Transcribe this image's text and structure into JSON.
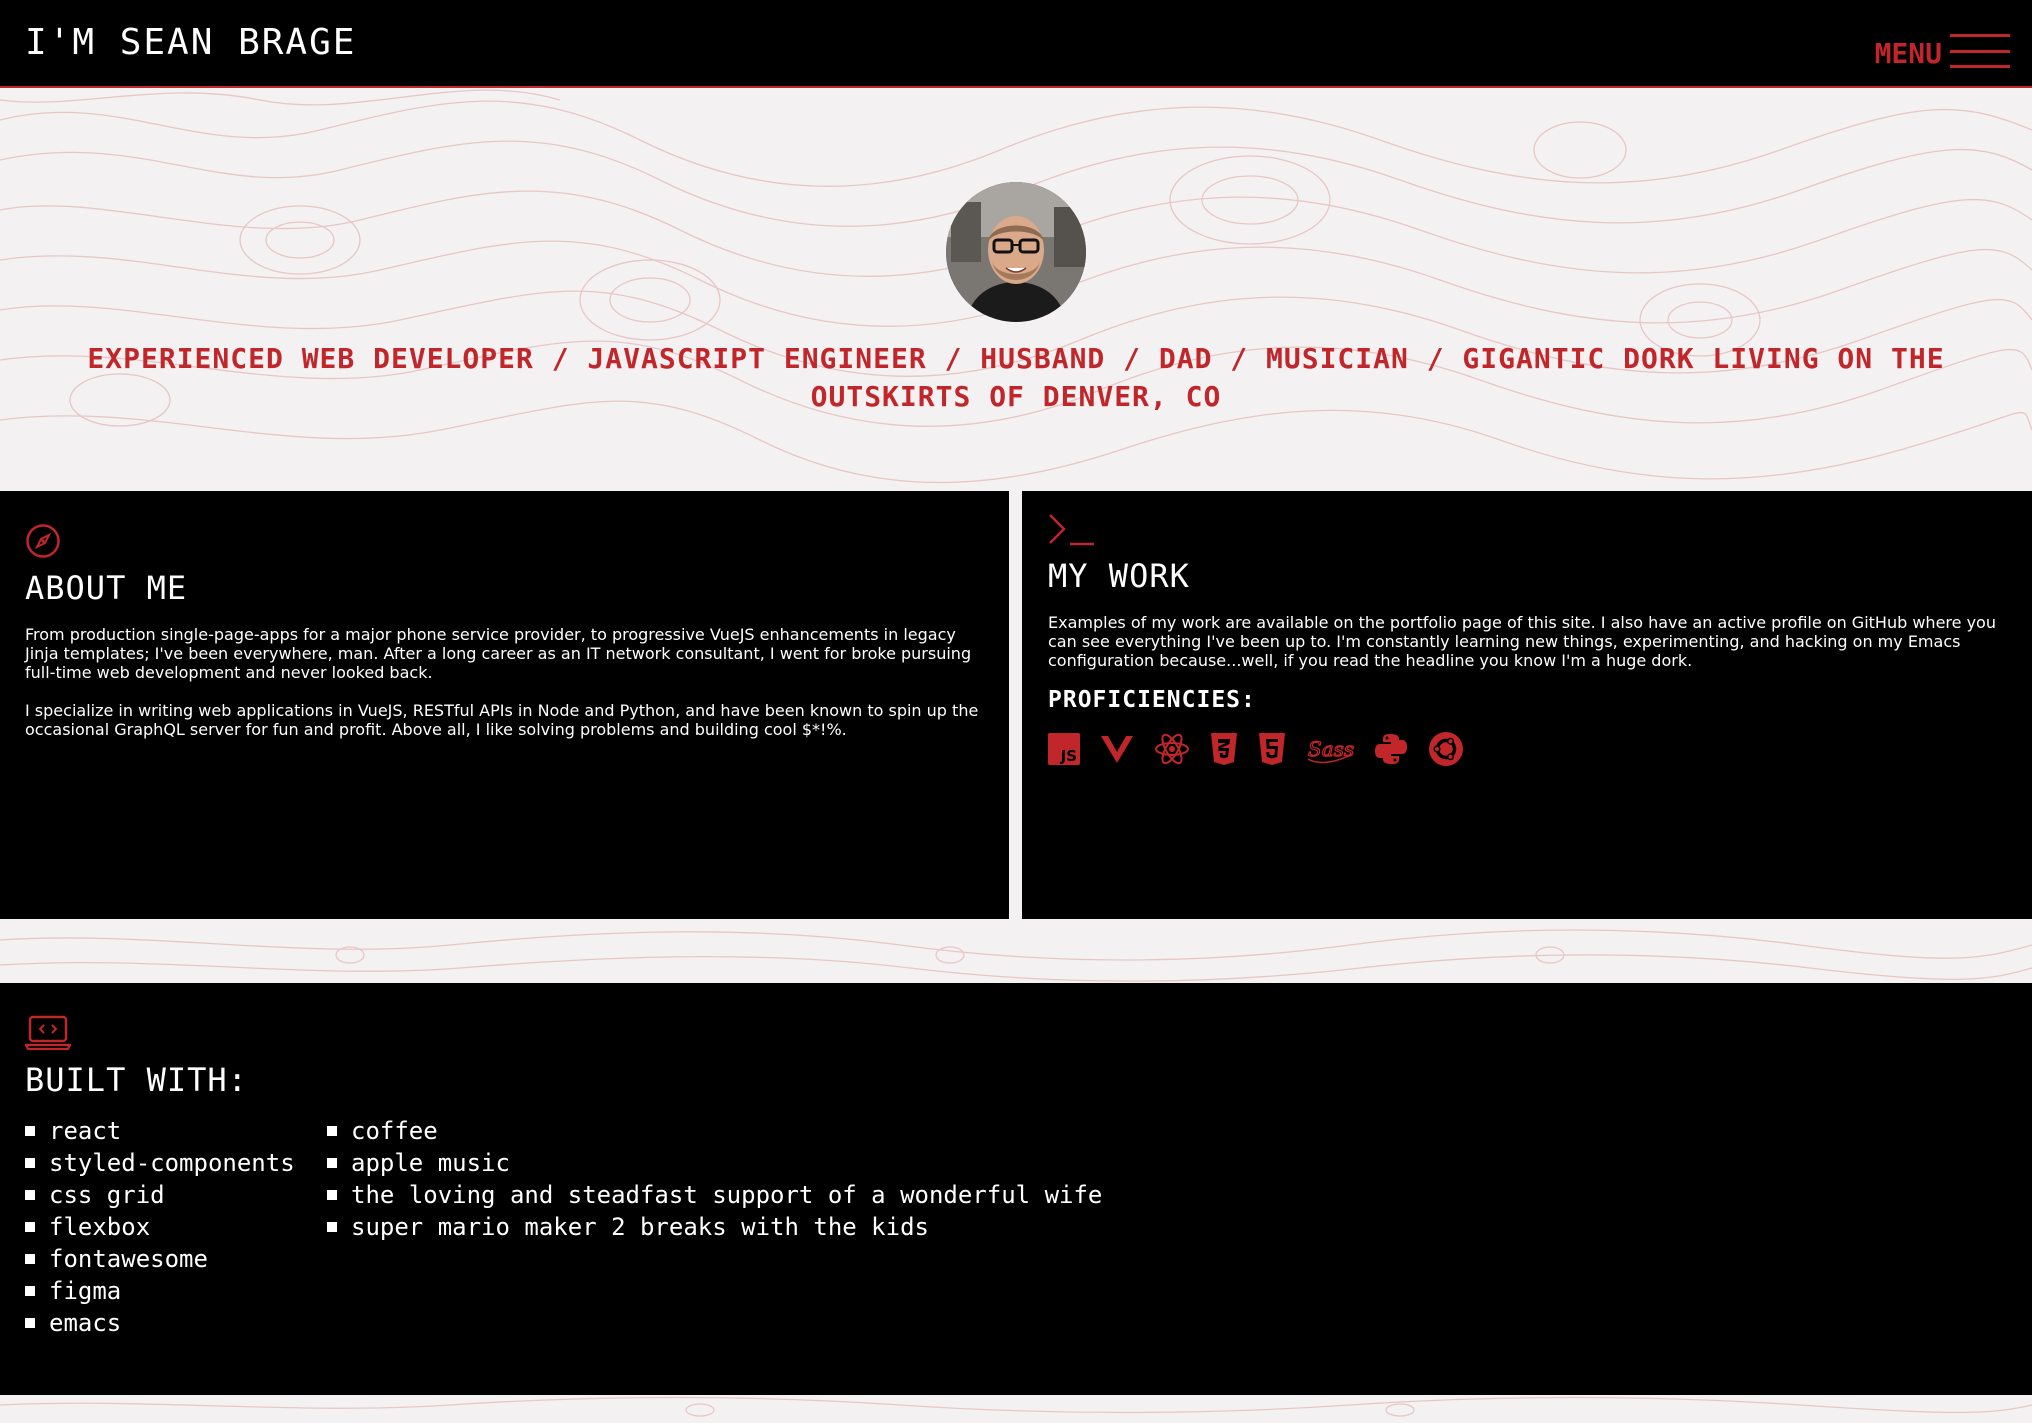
{
  "header": {
    "site_title": "I'M SEAN BRAGE",
    "menu_label": "MENU"
  },
  "hero": {
    "avatar_alt": "avatar",
    "tagline": "EXPERIENCED WEB DEVELOPER / JAVASCRIPT ENGINEER / HUSBAND / DAD / MUSICIAN / GIGANTIC DORK LIVING ON THE OUTSKIRTS OF DENVER, CO"
  },
  "about": {
    "icon": "compass-icon",
    "title": "ABOUT ME",
    "paragraph1": "From production single-page-apps for a major phone service provider, to progressive VueJS enhancements in legacy Jinja templates; I've been everywhere, man. After a long career as an IT network consultant, I went for broke pursuing full-time web development and never looked back.",
    "paragraph2": "I specialize in writing web applications in VueJS, RESTful APIs in Node and Python, and have been known to spin up the occasional GraphQL server for fun and profit. Above all, I like solving problems and building cool $*!%."
  },
  "work": {
    "icon": "terminal-icon",
    "title": "MY WORK",
    "paragraph": "Examples of my work are available on the portfolio page of this site. I also have an active profile on GitHub where you can see everything I've been up to. I'm constantly learning new things, experimenting, and hacking on my Emacs configuration because...well, if you read the headline you know I'm a huge dork.",
    "proficiencies_title": "PROFICIENCIES:",
    "proficiencies": [
      "js-icon",
      "vue-icon",
      "react-icon",
      "css3-icon",
      "html5-icon",
      "sass-icon",
      "python-icon",
      "ubuntu-icon"
    ]
  },
  "built": {
    "icon": "laptop-code-icon",
    "title": "BUILT WITH:",
    "col1": [
      "react",
      "styled-components",
      "css grid",
      "flexbox",
      "fontawesome",
      "figma",
      "emacs"
    ],
    "col2": [
      "coffee",
      "apple music",
      "the loving and steadfast support of a wonderful wife",
      "super mario maker 2 breaks with the kids"
    ]
  },
  "colors": {
    "accent": "#c0262a",
    "background": "#f3f1f1",
    "panel": "#000000"
  }
}
